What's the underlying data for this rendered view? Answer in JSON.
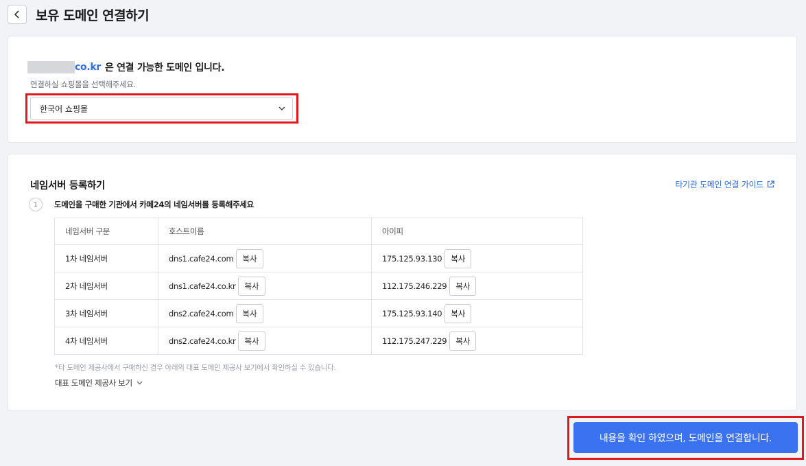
{
  "header": {
    "title": "보유 도메인 연결하기"
  },
  "domain_card": {
    "domain_suffix": "co.kr",
    "headline": "은 연결 가능한 도메인 입니다.",
    "subtext": "연결하실 쇼핑몰을 선택해주세요.",
    "mall_select": {
      "selected": "한국어 쇼핑몰"
    }
  },
  "nameserver_card": {
    "title": "네임서버 등록하기",
    "guide_link": "타기관 도메인 연결 가이드",
    "step_number": "1",
    "step_text": "도메인을 구매한 기관에서 카페24의 네임서버를 등록해주세요",
    "columns": [
      "네임서버 구분",
      "호스트이름",
      "아이피"
    ],
    "rows": [
      {
        "type": "1차 네임서버",
        "host": "dns1.cafe24.com",
        "ip": "175.125.93.130"
      },
      {
        "type": "2차 네임서버",
        "host": "dns1.cafe24.co.kr",
        "ip": "112.175.246.229"
      },
      {
        "type": "3차 네임서버",
        "host": "dns2.cafe24.com",
        "ip": "175.125.93.140"
      },
      {
        "type": "4차 네임서버",
        "host": "dns2.cafe24.co.kr",
        "ip": "112.175.247.229"
      }
    ],
    "copy_label": "복사",
    "note": "*타 도메인 제공사에서 구매하신 경우 아래의 대표 도메인 제공사 보기에서 확인하실 수 있습니다.",
    "providers_toggle": "대표 도메인 제공사 보기"
  },
  "confirm_button": "내용을 확인 하였으며, 도메인을 연결합니다.",
  "colors": {
    "accent": "#3b72f0",
    "highlight": "#e0181b",
    "link": "#2f6fe4"
  },
  "icons": [
    "chevron-left-icon",
    "chevron-down-icon",
    "external-link-icon"
  ]
}
